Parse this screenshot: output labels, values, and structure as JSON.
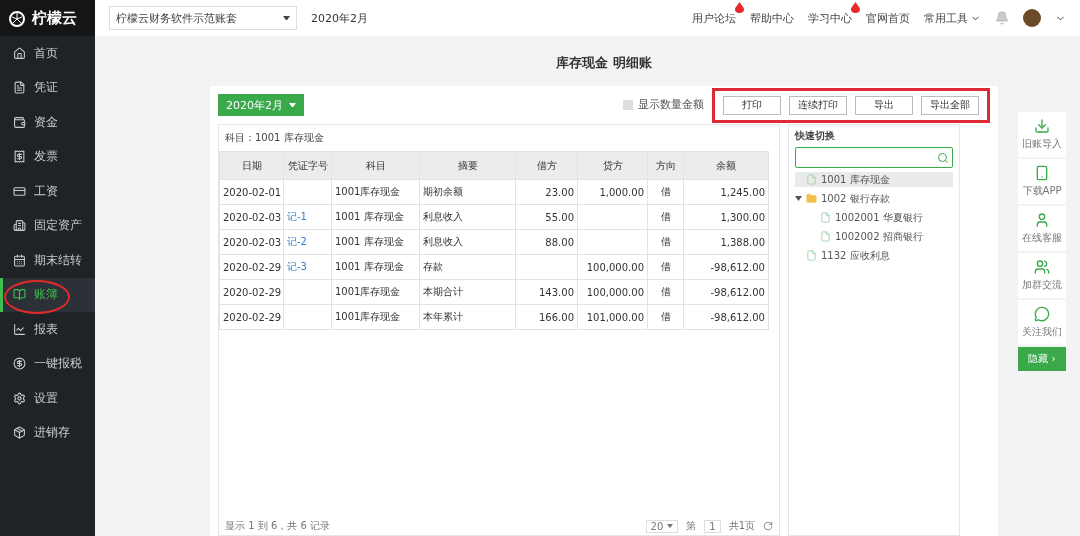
{
  "brand": {
    "name": "柠檬云"
  },
  "header": {
    "account_select": "柠檬云财务软件示范账套",
    "period": "2020年2月",
    "links": [
      {
        "label": "用户论坛",
        "hot": true,
        "dropdown": false
      },
      {
        "label": "帮助中心",
        "hot": false,
        "dropdown": false
      },
      {
        "label": "学习中心",
        "hot": true,
        "dropdown": false
      },
      {
        "label": "官网首页",
        "hot": false,
        "dropdown": false
      },
      {
        "label": "常用工具",
        "hot": false,
        "dropdown": true
      }
    ]
  },
  "sidebar": {
    "items": [
      {
        "label": "首页",
        "selected": false,
        "circled": false
      },
      {
        "label": "凭证",
        "selected": false,
        "circled": false
      },
      {
        "label": "资金",
        "selected": false,
        "circled": false
      },
      {
        "label": "发票",
        "selected": false,
        "circled": false
      },
      {
        "label": "工资",
        "selected": false,
        "circled": false
      },
      {
        "label": "固定资产",
        "selected": false,
        "circled": false
      },
      {
        "label": "期末结转",
        "selected": false,
        "circled": false
      },
      {
        "label": "账簿",
        "selected": true,
        "circled": true
      },
      {
        "label": "报表",
        "selected": false,
        "circled": false
      },
      {
        "label": "一键报税",
        "selected": false,
        "circled": false
      },
      {
        "label": "设置",
        "selected": false,
        "circled": false
      },
      {
        "label": "进销存",
        "selected": false,
        "circled": false
      }
    ]
  },
  "page_title": "库存现金 明细账",
  "toolbar": {
    "period_button": "2020年2月",
    "show_quantity": {
      "label": "显示数量金额",
      "checked": false
    },
    "buttons_highlighted": true,
    "buttons": [
      "打印",
      "连续打印",
      "导出",
      "导出全部"
    ]
  },
  "ledger": {
    "subject": "科目：1001 库存现金",
    "columns": [
      "日期",
      "凭证字号",
      "科目",
      "摘要",
      "借方",
      "贷方",
      "方向",
      "余额"
    ],
    "rows": [
      [
        "2020-02-01",
        "",
        "1001库存现金",
        "期初余额",
        "23.00",
        "1,000.00",
        "借",
        "1,245.00"
      ],
      [
        "2020-02-03",
        "记-1",
        "1001 库存现金",
        "利息收入",
        "55.00",
        "",
        "借",
        "1,300.00"
      ],
      [
        "2020-02-03",
        "记-2",
        "1001 库存现金",
        "利息收入",
        "88.00",
        "",
        "借",
        "1,388.00"
      ],
      [
        "2020-02-29",
        "记-3",
        "1001 库存现金",
        "存款",
        "",
        "100,000.00",
        "借",
        "-98,612.00"
      ],
      [
        "2020-02-29",
        "",
        "1001库存现金",
        "本期合计",
        "143.00",
        "100,000.00",
        "借",
        "-98,612.00"
      ],
      [
        "2020-02-29",
        "",
        "1001库存现金",
        "本年累计",
        "166.00",
        "101,000.00",
        "借",
        "-98,612.00"
      ]
    ],
    "pager": {
      "summary": "显示 1 到 6，共 6 记录",
      "page_size": "20",
      "page_label": "第",
      "page": "1",
      "total": "共1页"
    }
  },
  "quick_switch": {
    "title": "快速切换",
    "tree": [
      {
        "label": "1001 库存现金",
        "kind": "file",
        "selected": true
      },
      {
        "label": "1002 银行存款",
        "kind": "folder",
        "expanded": true,
        "selected": false,
        "children": [
          {
            "label": "1002001 华夏银行",
            "kind": "file",
            "selected": false
          },
          {
            "label": "1002002 招商银行",
            "kind": "file",
            "selected": false
          }
        ]
      },
      {
        "label": "1132 应收利息",
        "kind": "file",
        "selected": false
      }
    ]
  },
  "float_panel": {
    "items": [
      {
        "label": "旧账导入"
      },
      {
        "label": "下载APP"
      },
      {
        "label": "在线客服"
      },
      {
        "label": "加群交流"
      },
      {
        "label": "关注我们"
      }
    ],
    "hide_button": "隐藏 ›"
  }
}
